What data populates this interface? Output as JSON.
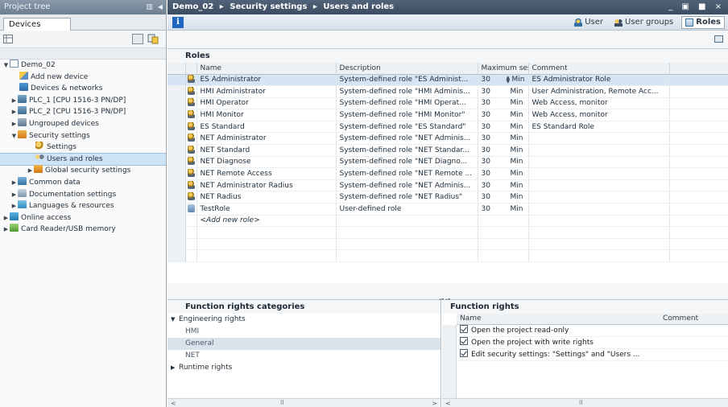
{
  "project_tree": {
    "title": "Project tree",
    "tab": "Devices",
    "items": [
      {
        "label": "Demo_02",
        "arrow": "▼",
        "icon": "project-icon",
        "level": 0
      },
      {
        "label": "Add new device",
        "arrow": "",
        "icon": "add-device-icon",
        "level": 1
      },
      {
        "label": "Devices & networks",
        "arrow": "",
        "icon": "network-icon",
        "level": 1
      },
      {
        "label": "PLC_1 [CPU 1516-3 PN/DP]",
        "arrow": "▶",
        "icon": "plc-icon",
        "level": 1
      },
      {
        "label": "PLC_2 [CPU 1516-3 PN/DP]",
        "arrow": "▶",
        "icon": "plc-icon",
        "level": 1
      },
      {
        "label": "Ungrouped devices",
        "arrow": "▶",
        "icon": "device-group-icon",
        "level": 1
      },
      {
        "label": "Security settings",
        "arrow": "▼",
        "icon": "security-folder-icon",
        "level": 1
      },
      {
        "label": "Settings",
        "arrow": "",
        "icon": "settings-user-icon",
        "level": 2
      },
      {
        "label": "Users and roles",
        "arrow": "",
        "icon": "users-icon",
        "level": 2,
        "selected": true
      },
      {
        "label": "Global security settings",
        "arrow": "▶",
        "icon": "security-folder-icon",
        "level": 2
      },
      {
        "label": "Common data",
        "arrow": "▶",
        "icon": "common-data-icon",
        "level": 1
      },
      {
        "label": "Documentation settings",
        "arrow": "▶",
        "icon": "documentation-icon",
        "level": 1
      },
      {
        "label": "Languages & resources",
        "arrow": "▶",
        "icon": "languages-icon",
        "level": 1
      },
      {
        "label": "Online access",
        "arrow": "▶",
        "icon": "online-access-icon",
        "level": 0
      },
      {
        "label": "Card Reader/USB memory",
        "arrow": "▶",
        "icon": "card-reader-icon",
        "level": 0
      }
    ]
  },
  "main": {
    "breadcrumb": [
      "Demo_02",
      "Security settings",
      "Users and roles"
    ],
    "breadcrumb_sep": "▸",
    "window_controls": "_ ▣ ■ ×",
    "info_label": "i",
    "view_tabs": [
      {
        "label": "User",
        "active": false
      },
      {
        "label": "User groups",
        "active": false
      },
      {
        "label": "Roles",
        "active": true
      }
    ]
  },
  "roles": {
    "title": "Roles",
    "columns": [
      "Name",
      "Description",
      "Maximum sess...",
      "Comment"
    ],
    "rows": [
      {
        "name": "ES Administrator",
        "description": "System-defined role \"ES Administ...",
        "max": "30",
        "unit": "Min",
        "comment": "ES Administrator Role",
        "selected": true,
        "spin": true
      },
      {
        "name": "HMI Administrator",
        "description": "System-defined role \"HMI Adminis...",
        "max": "30",
        "unit": "Min",
        "comment": "User Administration, Remote Acc..."
      },
      {
        "name": "HMI Operator",
        "description": "System-defined role \"HMI Operat...",
        "max": "30",
        "unit": "Min",
        "comment": "Web Access, monitor"
      },
      {
        "name": "HMI Monitor",
        "description": "System-defined role \"HMI Monitor\"",
        "max": "30",
        "unit": "Min",
        "comment": "Web Access, monitor"
      },
      {
        "name": "ES Standard",
        "description": "System-defined role \"ES Standard\"",
        "max": "30",
        "unit": "Min",
        "comment": "ES Standard Role"
      },
      {
        "name": "NET Administrator",
        "description": "System-defined role \"NET Adminis...",
        "max": "30",
        "unit": "Min",
        "comment": ""
      },
      {
        "name": "NET Standard",
        "description": "System-defined role \"NET Standar...",
        "max": "30",
        "unit": "Min",
        "comment": ""
      },
      {
        "name": "NET Diagnose",
        "description": "System-defined role \"NET Diagno...",
        "max": "30",
        "unit": "Min",
        "comment": ""
      },
      {
        "name": "NET Remote Access",
        "description": "System-defined role \"NET Remote ...",
        "max": "30",
        "unit": "Min",
        "comment": ""
      },
      {
        "name": "NET Administrator Radius",
        "description": "System-defined role \"NET Adminis...",
        "max": "30",
        "unit": "Min",
        "comment": ""
      },
      {
        "name": "NET Radius",
        "description": "System-defined role \"NET Radius\"",
        "max": "30",
        "unit": "Min",
        "comment": ""
      },
      {
        "name": "TestRole",
        "description": "User-defined role",
        "max": "30",
        "unit": "Min",
        "comment": "",
        "user_defined": true
      }
    ],
    "add_new": "<Add new role>"
  },
  "function_rights_categories": {
    "title": "Function rights categories",
    "items": [
      {
        "label": "Engineering rights",
        "arrow": "▼",
        "child": false
      },
      {
        "label": "HMI",
        "arrow": "",
        "child": true
      },
      {
        "label": "General",
        "arrow": "",
        "child": true,
        "selected": true
      },
      {
        "label": "NET",
        "arrow": "",
        "child": true
      },
      {
        "label": "Runtime rights",
        "arrow": "▶",
        "child": false
      }
    ],
    "scroll_left": "<",
    "scroll_right": ">",
    "scroll_mid": "II"
  },
  "function_rights": {
    "title": "Function rights",
    "columns": [
      "Name",
      "Comment"
    ],
    "rows": [
      {
        "label": "Open the project read-only",
        "checked": true
      },
      {
        "label": "Open the project with write rights",
        "checked": true
      },
      {
        "label": "Edit security settings: \"Settings\" and \"Users ...",
        "checked": true
      }
    ],
    "scroll_left": "<",
    "scroll_mid": "II"
  },
  "colors": {
    "title_bar": "#3b4c62",
    "selection": "#d6e5f4",
    "tree_selection": "#cfe3f6"
  }
}
